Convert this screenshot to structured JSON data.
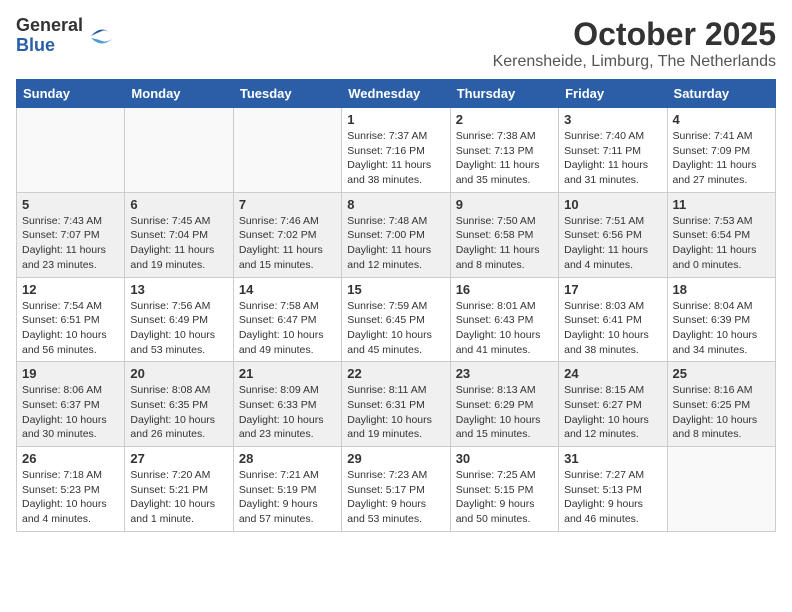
{
  "logo": {
    "general": "General",
    "blue": "Blue"
  },
  "title": {
    "month": "October 2025",
    "location": "Kerensheide, Limburg, The Netherlands"
  },
  "headers": [
    "Sunday",
    "Monday",
    "Tuesday",
    "Wednesday",
    "Thursday",
    "Friday",
    "Saturday"
  ],
  "weeks": [
    [
      {
        "day": "",
        "info": ""
      },
      {
        "day": "",
        "info": ""
      },
      {
        "day": "",
        "info": ""
      },
      {
        "day": "1",
        "info": "Sunrise: 7:37 AM\nSunset: 7:16 PM\nDaylight: 11 hours\nand 38 minutes."
      },
      {
        "day": "2",
        "info": "Sunrise: 7:38 AM\nSunset: 7:13 PM\nDaylight: 11 hours\nand 35 minutes."
      },
      {
        "day": "3",
        "info": "Sunrise: 7:40 AM\nSunset: 7:11 PM\nDaylight: 11 hours\nand 31 minutes."
      },
      {
        "day": "4",
        "info": "Sunrise: 7:41 AM\nSunset: 7:09 PM\nDaylight: 11 hours\nand 27 minutes."
      }
    ],
    [
      {
        "day": "5",
        "info": "Sunrise: 7:43 AM\nSunset: 7:07 PM\nDaylight: 11 hours\nand 23 minutes."
      },
      {
        "day": "6",
        "info": "Sunrise: 7:45 AM\nSunset: 7:04 PM\nDaylight: 11 hours\nand 19 minutes."
      },
      {
        "day": "7",
        "info": "Sunrise: 7:46 AM\nSunset: 7:02 PM\nDaylight: 11 hours\nand 15 minutes."
      },
      {
        "day": "8",
        "info": "Sunrise: 7:48 AM\nSunset: 7:00 PM\nDaylight: 11 hours\nand 12 minutes."
      },
      {
        "day": "9",
        "info": "Sunrise: 7:50 AM\nSunset: 6:58 PM\nDaylight: 11 hours\nand 8 minutes."
      },
      {
        "day": "10",
        "info": "Sunrise: 7:51 AM\nSunset: 6:56 PM\nDaylight: 11 hours\nand 4 minutes."
      },
      {
        "day": "11",
        "info": "Sunrise: 7:53 AM\nSunset: 6:54 PM\nDaylight: 11 hours\nand 0 minutes."
      }
    ],
    [
      {
        "day": "12",
        "info": "Sunrise: 7:54 AM\nSunset: 6:51 PM\nDaylight: 10 hours\nand 56 minutes."
      },
      {
        "day": "13",
        "info": "Sunrise: 7:56 AM\nSunset: 6:49 PM\nDaylight: 10 hours\nand 53 minutes."
      },
      {
        "day": "14",
        "info": "Sunrise: 7:58 AM\nSunset: 6:47 PM\nDaylight: 10 hours\nand 49 minutes."
      },
      {
        "day": "15",
        "info": "Sunrise: 7:59 AM\nSunset: 6:45 PM\nDaylight: 10 hours\nand 45 minutes."
      },
      {
        "day": "16",
        "info": "Sunrise: 8:01 AM\nSunset: 6:43 PM\nDaylight: 10 hours\nand 41 minutes."
      },
      {
        "day": "17",
        "info": "Sunrise: 8:03 AM\nSunset: 6:41 PM\nDaylight: 10 hours\nand 38 minutes."
      },
      {
        "day": "18",
        "info": "Sunrise: 8:04 AM\nSunset: 6:39 PM\nDaylight: 10 hours\nand 34 minutes."
      }
    ],
    [
      {
        "day": "19",
        "info": "Sunrise: 8:06 AM\nSunset: 6:37 PM\nDaylight: 10 hours\nand 30 minutes."
      },
      {
        "day": "20",
        "info": "Sunrise: 8:08 AM\nSunset: 6:35 PM\nDaylight: 10 hours\nand 26 minutes."
      },
      {
        "day": "21",
        "info": "Sunrise: 8:09 AM\nSunset: 6:33 PM\nDaylight: 10 hours\nand 23 minutes."
      },
      {
        "day": "22",
        "info": "Sunrise: 8:11 AM\nSunset: 6:31 PM\nDaylight: 10 hours\nand 19 minutes."
      },
      {
        "day": "23",
        "info": "Sunrise: 8:13 AM\nSunset: 6:29 PM\nDaylight: 10 hours\nand 15 minutes."
      },
      {
        "day": "24",
        "info": "Sunrise: 8:15 AM\nSunset: 6:27 PM\nDaylight: 10 hours\nand 12 minutes."
      },
      {
        "day": "25",
        "info": "Sunrise: 8:16 AM\nSunset: 6:25 PM\nDaylight: 10 hours\nand 8 minutes."
      }
    ],
    [
      {
        "day": "26",
        "info": "Sunrise: 7:18 AM\nSunset: 5:23 PM\nDaylight: 10 hours\nand 4 minutes."
      },
      {
        "day": "27",
        "info": "Sunrise: 7:20 AM\nSunset: 5:21 PM\nDaylight: 10 hours\nand 1 minute."
      },
      {
        "day": "28",
        "info": "Sunrise: 7:21 AM\nSunset: 5:19 PM\nDaylight: 9 hours\nand 57 minutes."
      },
      {
        "day": "29",
        "info": "Sunrise: 7:23 AM\nSunset: 5:17 PM\nDaylight: 9 hours\nand 53 minutes."
      },
      {
        "day": "30",
        "info": "Sunrise: 7:25 AM\nSunset: 5:15 PM\nDaylight: 9 hours\nand 50 minutes."
      },
      {
        "day": "31",
        "info": "Sunrise: 7:27 AM\nSunset: 5:13 PM\nDaylight: 9 hours\nand 46 minutes."
      },
      {
        "day": "",
        "info": ""
      }
    ]
  ]
}
